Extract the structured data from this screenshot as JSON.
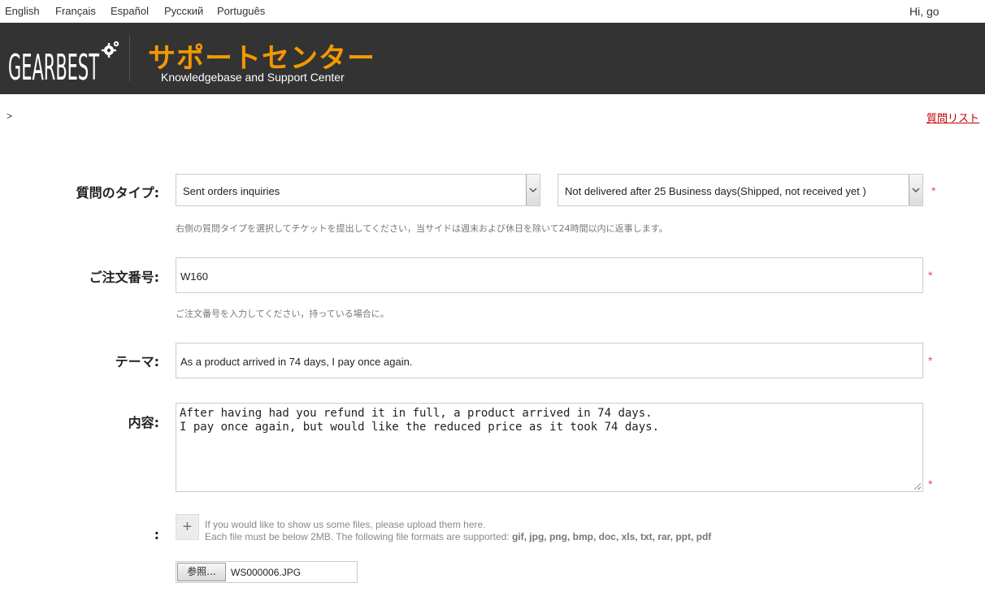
{
  "languages": [
    "English",
    "Français",
    "Español",
    "Русский",
    "Português"
  ],
  "greeting": "Hi, go",
  "header": {
    "logo_text": "GEARBEST",
    "title": "サポートセンター",
    "subtitle": "Knowledgebase and Support Center"
  },
  "breadcrumb": ">",
  "question_list_link": "質問リスト",
  "form": {
    "type_label": "質問のタイプ:",
    "type_select_1": "Sent orders inquiries",
    "type_select_2": "Not delivered after 25 Business days(Shipped, not received yet )",
    "type_hint": "右側の質問タイプを選択してチケットを提出してください，当サイドは週末および休日を除いて24時間以内に返事します。",
    "order_label": "ご注文番号:",
    "order_value": "W160",
    "order_hint": "ご注文番号を入力してください，持っている場合に。",
    "theme_label": "テーマ:",
    "theme_value": "As a product arrived in 74 days, I pay once again.",
    "content_label": "内容:",
    "content_line_1": "After having had you refund it in full, a product arrived in 74 days.",
    "content_line_2": "I pay once again, but would like the reduced price as it took 74 days.",
    "attach_label": ":",
    "required_mark": "*"
  },
  "upload": {
    "button_glyph": "+",
    "text_1": "If you would like to show us some files, please upload them here.",
    "text_2_prefix": "Each file must be below 2MB. The following file formats are supported: ",
    "formats": "gif, jpg, png, bmp, doc, xls, txt, rar, ppt, pdf",
    "browse_label": "参照...",
    "file_name": "WS000006.JPG"
  },
  "colors": {
    "header_bg": "#333333",
    "title_orange": "#f39800",
    "link_red": "#c00000",
    "required_red": "#d9534f"
  }
}
